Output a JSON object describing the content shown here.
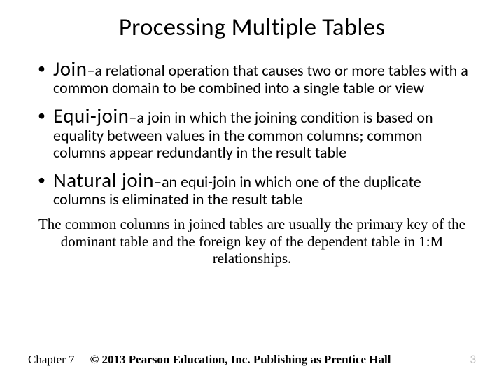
{
  "title": "Processing Multiple Tables",
  "bullets": [
    {
      "term": "Join",
      "desc": "–a relational operation that causes two or more tables with a common domain to be combined into a single table or view"
    },
    {
      "term": "Equi-join",
      "desc": "–a join in which the joining condition is based on equality between values in the common columns; common columns appear redundantly in the result table"
    },
    {
      "term": "Natural join",
      "desc": "–an equi-join in which one of the duplicate columns is eliminated in the result table"
    }
  ],
  "note": "The common columns in joined tables are usually the primary key of the dominant table and the foreign key of the dependent table in 1:M relationships.",
  "footer": {
    "chapter": "Chapter 7",
    "copyright": "© 2013 Pearson Education, Inc.  Publishing as Prentice Hall",
    "page": "3"
  }
}
